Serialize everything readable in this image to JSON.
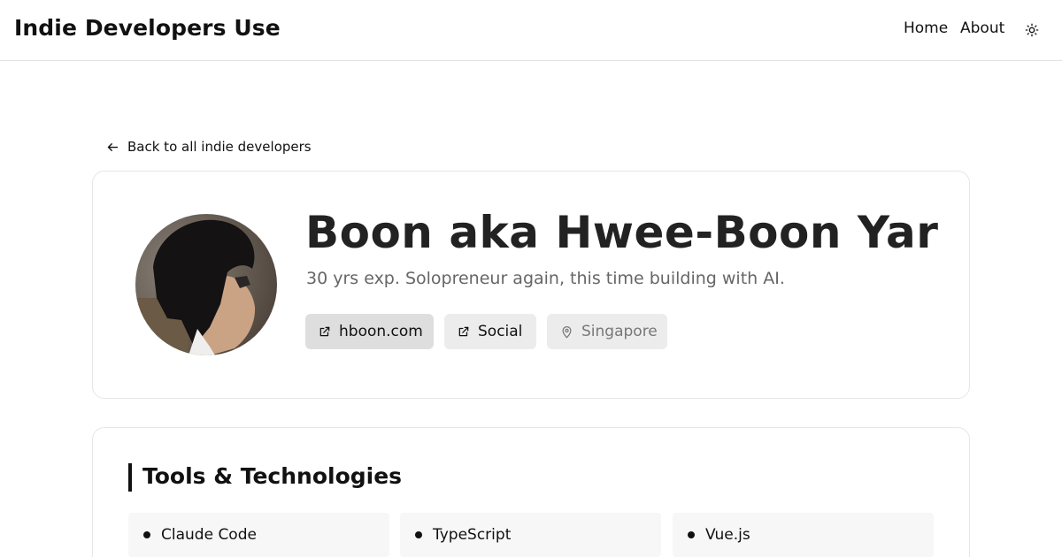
{
  "header": {
    "site_title": "Indie Developers Use",
    "nav": [
      {
        "label": "Home"
      },
      {
        "label": "About"
      }
    ],
    "theme_icon": "sun-icon"
  },
  "back_link": {
    "label": "Back to all indie developers",
    "icon": "arrow-left-icon"
  },
  "profile": {
    "name": "Boon aka Hwee-Boon Yar",
    "tagline": "30 yrs exp. Solopreneur again, this time building with AI.",
    "links": [
      {
        "label": "hboon.com",
        "icon": "external-link-icon"
      },
      {
        "label": "Social",
        "icon": "external-link-icon"
      }
    ],
    "location": {
      "label": "Singapore",
      "icon": "map-pin-icon"
    }
  },
  "tools": {
    "title": "Tools & Technologies",
    "items": [
      {
        "label": "Claude Code"
      },
      {
        "label": "TypeScript"
      },
      {
        "label": "Vue.js"
      }
    ]
  },
  "colors": {
    "text": "#111111",
    "muted": "#666666",
    "border": "#e6e6e6",
    "chip_active": "#dedede",
    "chip": "#ececec"
  }
}
